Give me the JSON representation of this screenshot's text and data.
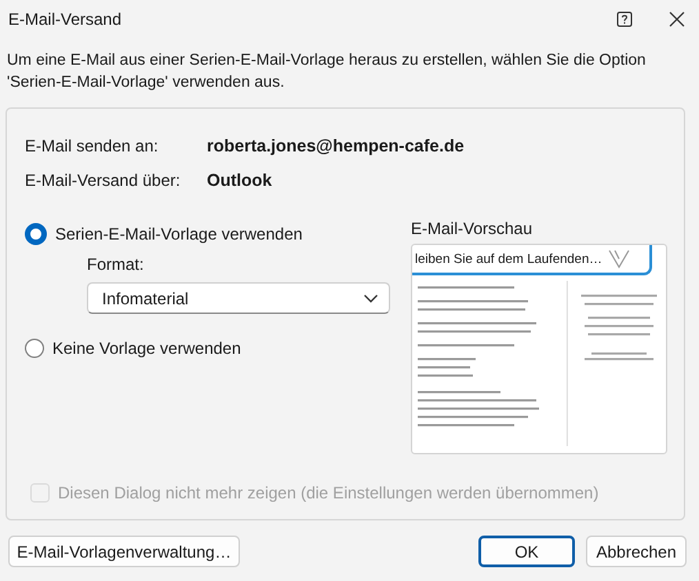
{
  "window": {
    "title": "E-Mail-Versand"
  },
  "intro": "Um eine E-Mail aus einer Serien-E-Mail-Vorlage heraus zu erstellen, wählen Sie die Option 'Serien-E-Mail-Vorlage' verwenden aus.",
  "details": [
    {
      "label": "E-Mail senden an:",
      "value": "roberta.jones@hempen-cafe.de"
    },
    {
      "label": "E-Mail-Versand über:",
      "value": "Outlook"
    }
  ],
  "options": [
    {
      "label": "Serien-E-Mail-Vorlage verwenden",
      "selected": true
    },
    {
      "label": "Keine Vorlage verwenden",
      "selected": false
    }
  ],
  "format": {
    "label": "Format:",
    "value": "Infomaterial"
  },
  "preview": {
    "label": "E-Mail-Vorschau",
    "heading": "leiben Sie auf dem Laufenden…"
  },
  "dont_show": {
    "label": "Diesen Dialog nicht mehr zeigen (die Einstellungen werden übernommen)",
    "checked": false,
    "disabled": true
  },
  "buttons": [
    {
      "label": "E-Mail-Vorlagenverwaltung…",
      "default": false
    },
    {
      "label": "OK",
      "default": true
    },
    {
      "label": "Abbrechen",
      "default": false
    }
  ]
}
